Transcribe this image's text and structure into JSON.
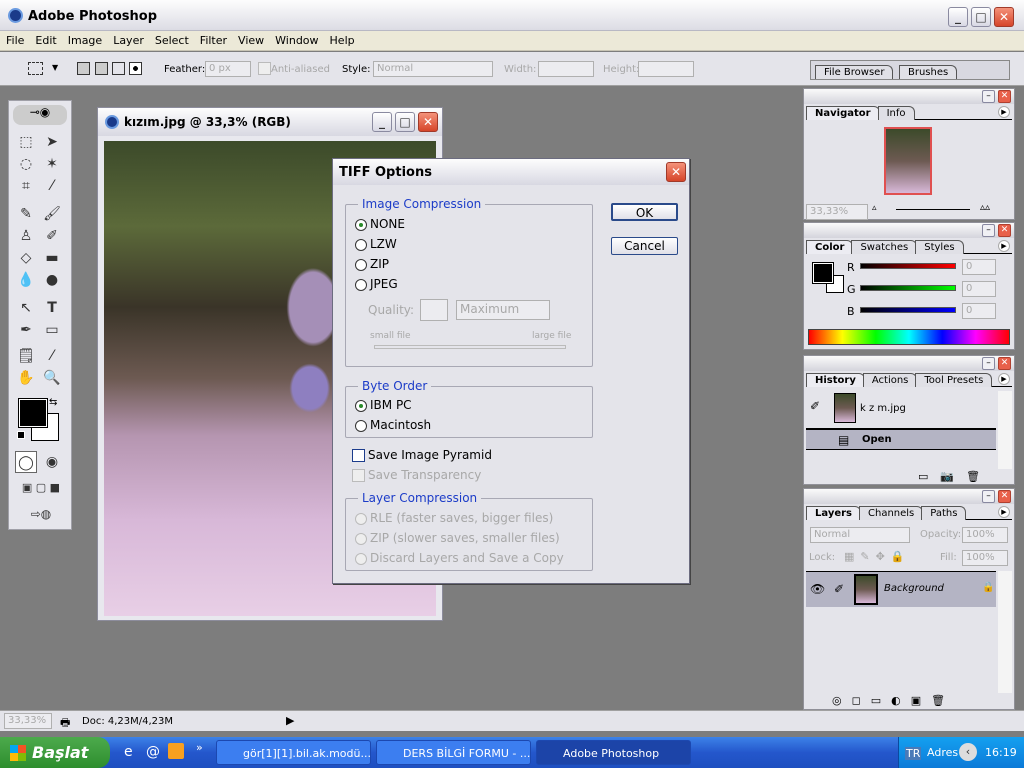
{
  "app": {
    "title": "Adobe Photoshop",
    "icon": "photoshop-icon"
  },
  "menu": [
    "File",
    "Edit",
    "Image",
    "Layer",
    "Select",
    "Filter",
    "View",
    "Window",
    "Help"
  ],
  "options": {
    "feather_label": "Feather:",
    "feather_value": "0 px",
    "anti_aliased": "Anti-aliased",
    "style_label": "Style:",
    "style_value": "Normal",
    "width_label": "Width:",
    "height_label": "Height:",
    "file_browser": "File Browser",
    "brushes": "Brushes"
  },
  "document": {
    "title": "kızım.jpg @ 33,3% (RGB)"
  },
  "dialog": {
    "title": "TIFF Options",
    "ok": "OK",
    "cancel": "Cancel",
    "image_compression": {
      "legend": "Image Compression",
      "options": [
        "NONE",
        "LZW",
        "ZIP",
        "JPEG"
      ],
      "selected": "NONE",
      "quality_label": "Quality:",
      "quality_value": "Maximum",
      "small_file": "small file",
      "large_file": "large file"
    },
    "byte_order": {
      "legend": "Byte Order",
      "options": [
        "IBM PC",
        "Macintosh"
      ],
      "selected": "IBM PC"
    },
    "save_image_pyramid": "Save Image Pyramid",
    "save_image_pyramid_checked": false,
    "save_transparency": "Save Transparency",
    "layer_compression": {
      "legend": "Layer Compression",
      "options": [
        "RLE (faster saves, bigger files)",
        "ZIP (slower saves, smaller files)",
        "Discard Layers and Save a Copy"
      ]
    }
  },
  "navigator": {
    "tabs": [
      "Navigator",
      "Info"
    ],
    "zoom": "33,33%"
  },
  "color": {
    "tabs": [
      "Color",
      "Swatches",
      "Styles"
    ],
    "channels": [
      {
        "label": "R",
        "value": "0"
      },
      {
        "label": "G",
        "value": "0"
      },
      {
        "label": "B",
        "value": "0"
      }
    ],
    "foreground": "#000000",
    "background": "#ffffff"
  },
  "history": {
    "tabs": [
      "History",
      "Actions",
      "Tool Presets"
    ],
    "snapshot": "k z m.jpg",
    "items": [
      "Open"
    ]
  },
  "layers": {
    "tabs": [
      "Layers",
      "Channels",
      "Paths"
    ],
    "blend": "Normal",
    "opacity_label": "Opacity:",
    "opacity": "100%",
    "lock_label": "Lock:",
    "fill_label": "Fill:",
    "fill": "100%",
    "items": [
      "Background"
    ]
  },
  "status": {
    "zoom": "33,33%",
    "doc": "Doc: 4,23M/4,23M"
  },
  "taskbar": {
    "start": "Başlat",
    "tasks": [
      "gör[1][1].bil.ak.modü...",
      "DERS BİLGİ FORMU - ...",
      "Adobe Photoshop"
    ],
    "lang": "TR",
    "address": "Adres",
    "clock": "16:19"
  }
}
